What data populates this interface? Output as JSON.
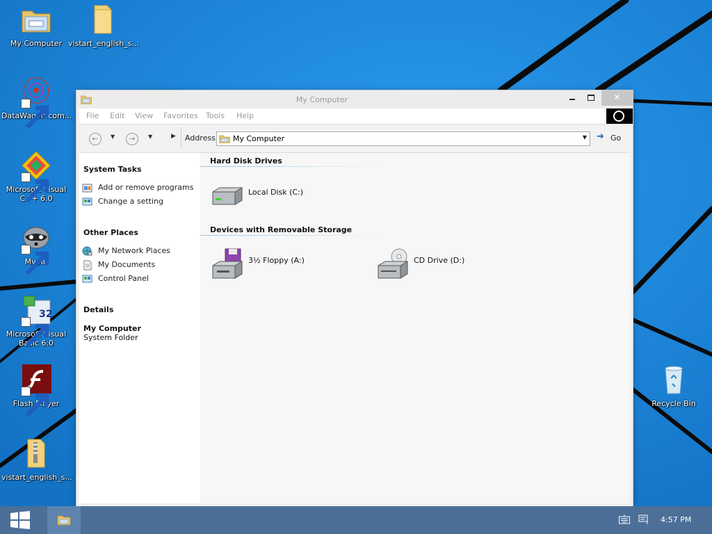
{
  "desktop": {
    "icons": [
      {
        "label": "My Computer"
      },
      {
        "label": "vistart_english_s..."
      },
      {
        "label": "DataWagon.com..."
      },
      {
        "label": "Microsoft Visual C++ 6.0"
      },
      {
        "label": "Mypal"
      },
      {
        "label": "Microsoft Visual Basic 6.0"
      },
      {
        "label": "Flash Player"
      },
      {
        "label": "vistart_english_s..."
      },
      {
        "label": "Recycle Bin"
      }
    ]
  },
  "window": {
    "title": "My Computer",
    "menu": [
      "File",
      "Edit",
      "View",
      "Favorites",
      "Tools",
      "Help"
    ],
    "toolbar": {
      "address_label": "Address",
      "address_value": "My Computer",
      "go_label": "Go"
    },
    "taskpane": {
      "system_tasks": {
        "title": "System Tasks",
        "items": [
          "Add or remove programs",
          "Change a setting"
        ]
      },
      "other_places": {
        "title": "Other Places",
        "items": [
          "My Network Places",
          "My Documents",
          "Control Panel"
        ]
      },
      "details": {
        "title": "Details",
        "name": "My Computer",
        "type": "System Folder"
      }
    },
    "content": {
      "groups": [
        {
          "title": "Hard Disk Drives",
          "drives": [
            "Local Disk (C:)"
          ]
        },
        {
          "title": "Devices with Removable Storage",
          "drives": [
            "3½ Floppy (A:)",
            "CD Drive (D:)"
          ]
        }
      ]
    }
  },
  "taskbar": {
    "clock": "4:57 PM"
  },
  "colors": {
    "wallpaper": "#1f86d8",
    "taskbar": "#4b6f97",
    "close_button": "#c7c7c7",
    "link_accent": "#1d5fbf"
  }
}
